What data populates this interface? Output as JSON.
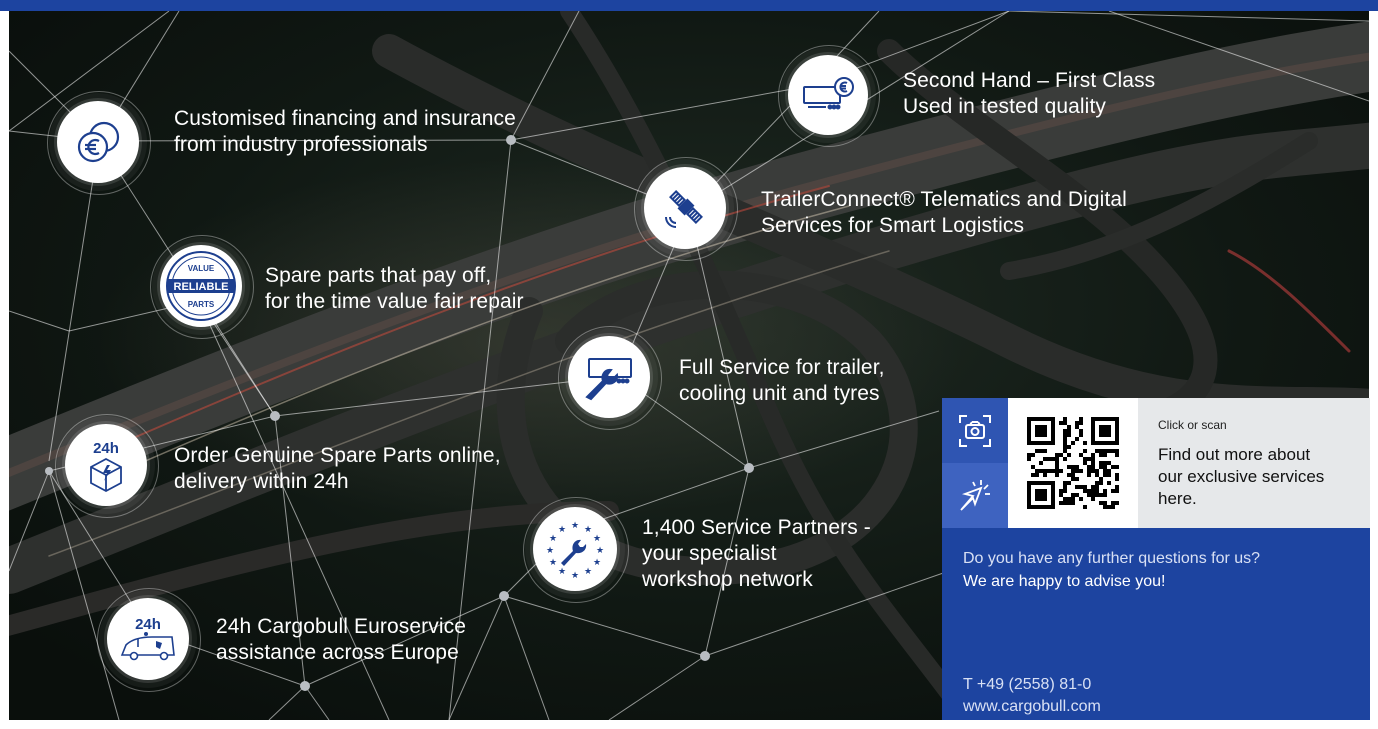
{
  "features": [
    {
      "id": "financing",
      "icon": "euro-coins-icon",
      "lines": [
        "Customised financing and insurance",
        "from industry professionals"
      ]
    },
    {
      "id": "used",
      "icon": "trailer-euro-icon",
      "lines": [
        "Second Hand – First Class",
        "Used in tested quality"
      ]
    },
    {
      "id": "telematics",
      "icon": "satellite-icon",
      "lines": [
        "TrailerConnect® Telematics and Digital",
        "Services for Smart Logistics"
      ]
    },
    {
      "id": "spare",
      "icon": "reliable-parts-badge-icon",
      "badge": {
        "top": "VALUE",
        "middle": "RELIABLE",
        "bottom": "PARTS"
      },
      "lines": [
        "Spare parts that pay off,",
        "for the time value fair repair"
      ]
    },
    {
      "id": "fullservice",
      "icon": "cooling-unit-wrench-icon",
      "lines": [
        "Full Service for trailer,",
        "cooling unit and tyres"
      ]
    },
    {
      "id": "order",
      "icon": "parcel-24h-icon",
      "badge_text": "24h",
      "lines": [
        "Order Genuine Spare Parts online,",
        "delivery within 24h"
      ]
    },
    {
      "id": "partners",
      "icon": "eu-stars-wrench-icon",
      "lines": [
        "1,400 Service Partners -",
        "your specialist",
        "workshop network"
      ]
    },
    {
      "id": "euroservice",
      "icon": "service-van-24h-icon",
      "badge_text": "24h",
      "lines": [
        "24h Cargobull Euroservice",
        "assistance across Europe"
      ]
    }
  ],
  "panel": {
    "scan_label": "Click or scan",
    "scan_lines": [
      "Find out more about",
      "our exclusive services",
      "here."
    ],
    "question": "Do you have any further questions for us?",
    "advise": "We are happy to advise you!",
    "phone": "T  +49 (2558) 81-0",
    "website": "www.cargobull.com",
    "icons": {
      "camera": "camera-scan-icon",
      "click": "click-cursor-icon",
      "qr": "qr-code-icon"
    }
  },
  "colors": {
    "brand_blue": "#1d44a0",
    "icon_blue": "#1d3f8f",
    "panel_grey": "#e6e8ea"
  }
}
